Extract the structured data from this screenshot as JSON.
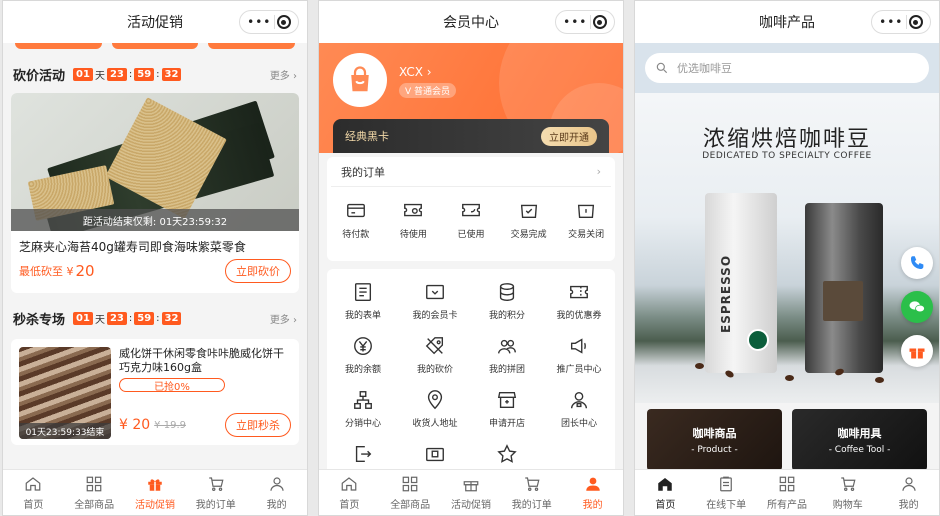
{
  "p1": {
    "title": "活动促销",
    "bargain": {
      "title": "砍价活动",
      "cd": [
        "01",
        "天",
        "23",
        "59",
        "32"
      ],
      "more": "更多 ›",
      "tip": "距活动结束仅剩: 01天23:59:32",
      "name": "芝麻夹心海苔40g罐寿司即食海味紫菜零食",
      "price_label": "最低砍至 ¥",
      "price": "20",
      "btn": "立即砍价"
    },
    "seckill": {
      "title": "秒杀专场",
      "cd": [
        "01",
        "天",
        "23",
        "59",
        "32"
      ],
      "more": "更多 ›",
      "tip": "01天23:59:33结束",
      "name": "威化饼干休闲零食咔咔脆威化饼干巧克力味160g盒",
      "progress": "已抢0%",
      "price": "¥ 20",
      "old": "¥ 19.9",
      "btn": "立即秒杀"
    },
    "tabs": [
      "首页",
      "全部商品",
      "活动促销",
      "我的订单",
      "我的"
    ]
  },
  "p2": {
    "title": "会员中心",
    "user": "XCX ›",
    "level": "V 普通会员",
    "blackcard": "经典黑卡",
    "open": "立即开通",
    "orders_title": "我的订单",
    "orders": [
      "待付款",
      "待使用",
      "已使用",
      "交易完成",
      "交易关闭"
    ],
    "grid": [
      "我的表单",
      "我的会员卡",
      "我的积分",
      "我的优惠券",
      "我的余额",
      "我的砍价",
      "我的拼团",
      "推广员中心",
      "分销中心",
      "收货人地址",
      "申请开店",
      "团长中心"
    ],
    "tabs": [
      "首页",
      "全部商品",
      "活动促销",
      "我的订单",
      "我的"
    ]
  },
  "p3": {
    "title": "咖啡产品",
    "search": "优选咖啡豆",
    "banner_title": "浓缩烘焙咖啡豆",
    "banner_sub": "DEDICATED TO SPECIALTY COFFEE",
    "bag_label": "ESPRESSO",
    "cat1": {
      "a": "咖啡商品",
      "b": "- Product -"
    },
    "cat2": {
      "a": "咖啡用具",
      "b": "- Coffee Tool -"
    },
    "tabs": [
      "首页",
      "在线下单",
      "所有产品",
      "购物车",
      "我的"
    ]
  },
  "colors": {
    "accent": "#ff5a1f"
  }
}
